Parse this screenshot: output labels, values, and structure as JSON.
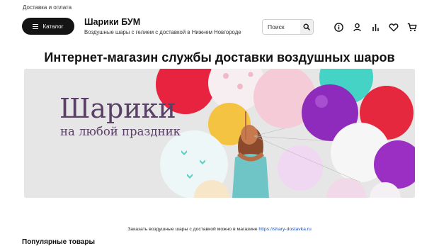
{
  "header": {
    "top_link": "Доставка и оплата",
    "catalog_label": "Каталог",
    "shop_name": "Шарики БУМ",
    "shop_description": "Воздушные шары с гелием с доставкой в Нижнем Новгороде",
    "search_placeholder": "Поиск",
    "icons": [
      "info-icon",
      "user-icon",
      "stats-icon",
      "heart-icon",
      "cart-icon"
    ]
  },
  "main": {
    "title": "Интернет-магазин службы доставки воздушных шаров",
    "banner": {
      "title": "Шарики",
      "subtitle": "на любой праздник"
    },
    "order_note": {
      "text": "Заказать воздушные шары с доставкой можно в магазине ",
      "link_text": "https://shary-dostavka.ru"
    },
    "popular_heading": "Популярные товары"
  },
  "colors": {
    "catalog_bg": "#141414",
    "banner_text": "#5a3f66",
    "link": "#1a4fbf",
    "banner_bg": "#e4e4e4"
  }
}
